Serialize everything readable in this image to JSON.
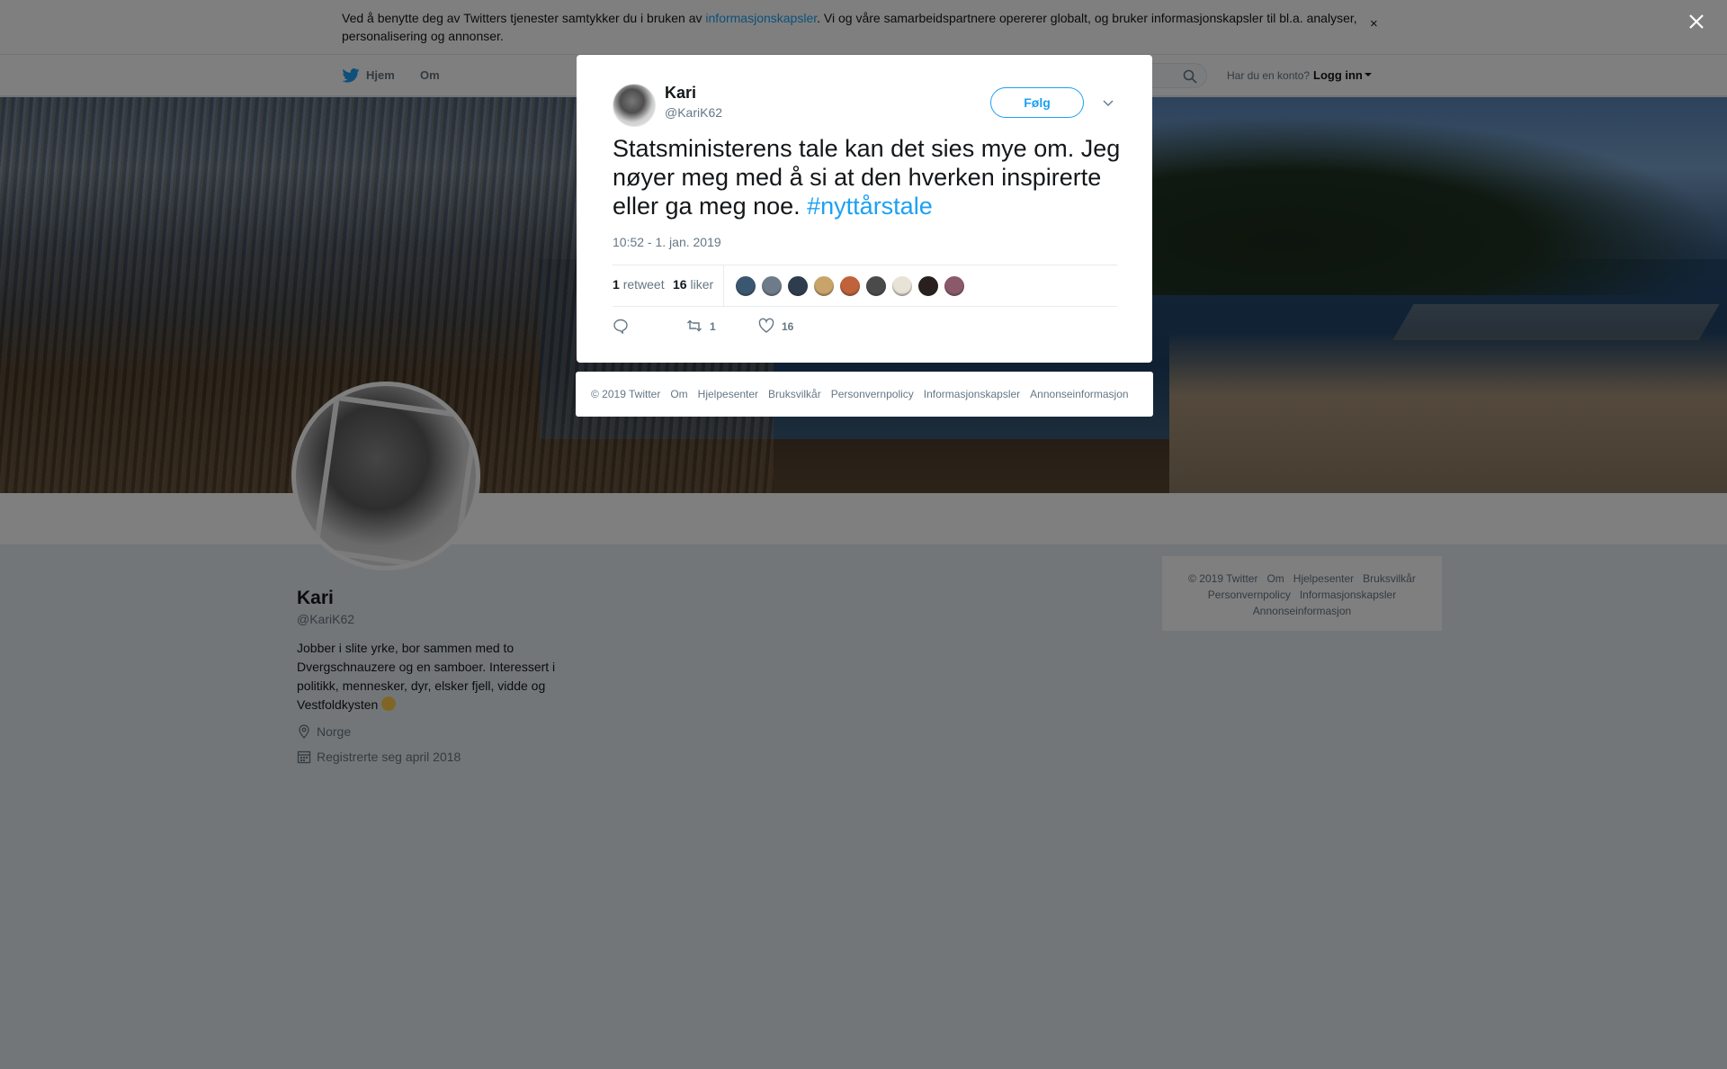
{
  "cookie": {
    "text_before": "Ved å benytte deg av Twitters tjenester samtykker du i bruken av ",
    "link": "informasjonskapsler",
    "text_after": ". Vi og våre samarbeidspartnere opererer globalt, og bruker informasjonskapsler til bl.a. analyser, personalisering og annonser.",
    "close": "×"
  },
  "nav": {
    "home": "Hjem",
    "about": "Om",
    "account_prompt": "Har du en konto?",
    "login": "Logg inn"
  },
  "profile": {
    "name": "Kari",
    "handle": "@KariK62",
    "bio": "Jobber i slite yrke, bor sammen med to Dvergschnauzere og en samboer. Interessert i politikk, mennesker, dyr, elsker fjell, vidde og Vestfoldkysten",
    "location": "Norge",
    "joined": "Registrerte seg april 2018"
  },
  "side_footer": {
    "row1": [
      "© 2019 Twitter",
      "Om",
      "Hjelpesenter",
      "Bruksvilkår"
    ],
    "row2": [
      "Personvernpolicy",
      "Informasjonskapsler"
    ],
    "row3": [
      "Annonseinformasjon"
    ]
  },
  "tweet": {
    "name": "Kari",
    "handle": "@KariK62",
    "follow": "Følg",
    "text": "Statsministerens tale kan det sies mye om. Jeg nøyer meg med å si at den hverken inspirerte eller ga meg noe. ",
    "hashtag": "#nyttårstale",
    "time": "10:52 - 1. jan. 2019",
    "retweets_count": "1",
    "retweets_label": "retweet",
    "likes_count": "16",
    "likes_label": "liker",
    "action_retweets": "1",
    "action_likes": "16",
    "liker_face_colors": [
      "#3b5670",
      "#6e7c8a",
      "#2d3d4f",
      "#c9a46a",
      "#c0623a",
      "#4a4a4a",
      "#e9e2d6",
      "#2a1f1f",
      "#8a5a6a"
    ]
  },
  "modal_footer": [
    "© 2019 Twitter",
    "Om",
    "Hjelpesenter",
    "Bruksvilkår",
    "Personvernpolicy",
    "Informasjonskapsler",
    "Annonseinformasjon"
  ],
  "colors": {
    "brand_blue": "#1da1f2",
    "muted_text": "#657786",
    "overlay": "rgba(0,0,0,0.5)"
  },
  "icons": [
    "twitter-bird-icon",
    "search-icon",
    "close-icon",
    "chevron-down-icon",
    "location-pin-icon",
    "calendar-icon",
    "reply-icon",
    "retweet-icon",
    "heart-icon"
  ]
}
